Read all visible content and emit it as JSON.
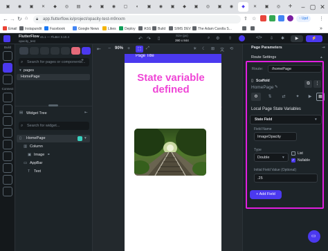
{
  "browser": {
    "active_tab_title": "",
    "url": "app.flutterflow.io/project/opacity-test-m9rxxm",
    "bookmarks": [
      "Email",
      "Instapundit",
      "Facebook",
      "Google News",
      "Likes",
      "Deploy",
      "ASG",
      "Build",
      "SIMS DEV",
      "The Adam Carolla S..."
    ],
    "update_label": "Upd"
  },
  "app": {
    "brand": "FlutterFlow",
    "version": "v5.1 — Flutter 3.10.4",
    "project_name": "opacity_test",
    "device_size_label": "Size (px)",
    "device_size_value": "390 x 844",
    "zoom": "90%"
  },
  "rail": {
    "build_label": "Build",
    "connect_label": "Connect"
  },
  "left_panel": {
    "page_search_placeholder": "Search for pages or components...",
    "pages_folder": "pages",
    "page_item": "HomePage",
    "widget_tree_title": "Widget Tree",
    "widget_search_placeholder": "Search for widget...",
    "tree": [
      {
        "label": "HomePage",
        "selected": true
      },
      {
        "label": "Column",
        "selected": false
      },
      {
        "label": "Image",
        "selected": false
      },
      {
        "label": "AppBar",
        "selected": false
      },
      {
        "label": "Text",
        "selected": false
      }
    ]
  },
  "canvas": {
    "appbar_title": "Page Title",
    "annotation": "State variable defined",
    "annotation_color": "#ef45d6"
  },
  "right_panel": {
    "title": "Page Parameters",
    "section_route": "Route Settings",
    "route_label": "Route:",
    "route_value": "/homePage",
    "widget_type": "Scaffold",
    "widget_name": "HomePage",
    "local_state_title": "Local Page State Variables",
    "state_field_header": "State Field",
    "field_name_label": "Field Name",
    "field_name_value": "ImageOpacity",
    "type_label": "Type",
    "type_value": "Double",
    "list_label": "List",
    "list_checked": false,
    "nullable_label": "Nullable",
    "nullable_checked": true,
    "initial_value_label": "Initial Field Value (Optional)",
    "initial_value": ".25",
    "add_field_label": "+ Add Field",
    "highlight_color": "#e21ee0"
  }
}
